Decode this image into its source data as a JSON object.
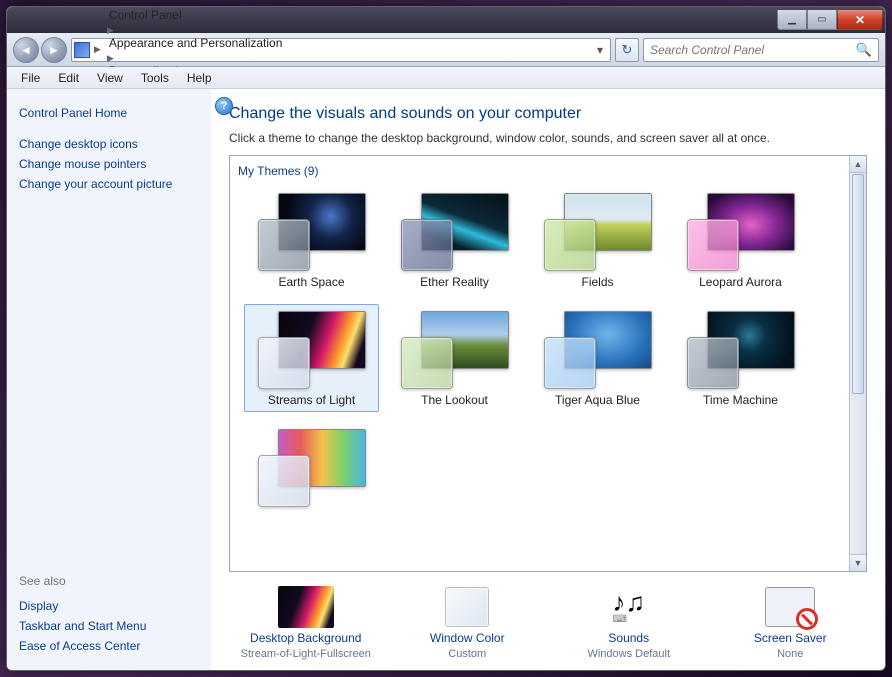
{
  "breadcrumb": [
    "Control Panel",
    "Appearance and Personalization",
    "Personalization"
  ],
  "search_placeholder": "Search Control Panel",
  "menu": [
    "File",
    "Edit",
    "View",
    "Tools",
    "Help"
  ],
  "sidebar": {
    "home": "Control Panel Home",
    "links": [
      "Change desktop icons",
      "Change mouse pointers",
      "Change your account picture"
    ],
    "see_also_head": "See also",
    "see_also": [
      "Display",
      "Taskbar and Start Menu",
      "Ease of Access Center"
    ]
  },
  "main": {
    "title": "Change the visuals and sounds on your computer",
    "subtitle": "Click a theme to change the desktop background, window color, sounds, and screen saver all at once.",
    "group": "My Themes (9)"
  },
  "themes": [
    {
      "label": "Earth Space",
      "wall": "radial-gradient(circle at 60% 40%,#4a77c7 0%,#12244a 35%,#050914 70%)",
      "glass": "linear-gradient(135deg,rgba(185,195,205,.85),rgba(120,132,145,.7))"
    },
    {
      "label": "Ether Reality",
      "wall": "linear-gradient(200deg,#051018,#0c2a38 45%,#2fbada 60%,#062028 80%)",
      "glass": "linear-gradient(135deg,rgba(150,160,190,.85),rgba(80,90,130,.7))"
    },
    {
      "label": "Fields",
      "wall": "linear-gradient(#cfe4ef 0%,#dfe9f0 45%,#c1cf5a 55%,#6e8a2d 100%)",
      "glass": "linear-gradient(135deg,rgba(210,235,175,.85),rgba(165,200,120,.7))"
    },
    {
      "label": "Leopard Aurora",
      "wall": "radial-gradient(ellipse at 50% 55%,#e463c5 0%,#8a2a9b 40%,#2a0a3b 85%)",
      "glass": "linear-gradient(135deg,rgba(250,180,225,.85),rgba(235,120,200,.7))"
    },
    {
      "label": "Streams of Light",
      "wall": "linear-gradient(110deg,#08060c 0%,#120a20 35%,#d51a6a 55%,#ff9a2a 70%,#ffe070 78%,#120a20 90%)",
      "glass": "linear-gradient(135deg,rgba(240,244,250,.9),rgba(205,215,230,.75))"
    },
    {
      "label": "The Lookout",
      "wall": "linear-gradient(#6fa7dd 0%,#aecdea 40%,#6b8b3a 60%,#2f4a1e 100%)",
      "glass": "linear-gradient(135deg,rgba(215,235,195,.85),rgba(175,205,150,.7))"
    },
    {
      "label": "Tiger Aqua Blue",
      "wall": "radial-gradient(ellipse at 50% 40%,#6fb4e8,#2a72bd 60%,#154a82 100%)",
      "glass": "linear-gradient(135deg,rgba(200,225,250,.85),rgba(150,195,240,.7))"
    },
    {
      "label": "Time Machine",
      "wall": "radial-gradient(circle at 48% 42%,#2a7a9a 0%,#0a3044 30%,#03121c 80%)",
      "glass": "linear-gradient(135deg,rgba(185,195,205,.85),rgba(120,132,145,.7))"
    },
    {
      "label": "",
      "wall": "linear-gradient(90deg,#c85ac4,#e85a5a,#f2c24a,#7ad06a,#4ab4e2)",
      "glass": "linear-gradient(135deg,rgba(240,244,250,.9),rgba(205,215,230,.75))"
    }
  ],
  "selected_theme": 4,
  "bottom": [
    {
      "label": "Desktop Background",
      "value": "Stream-of-Light-Fullscreen",
      "icon": "bg"
    },
    {
      "label": "Window Color",
      "value": "Custom",
      "icon": "color"
    },
    {
      "label": "Sounds",
      "value": "Windows Default",
      "icon": "sounds"
    },
    {
      "label": "Screen Saver",
      "value": "None",
      "icon": "saver"
    }
  ]
}
